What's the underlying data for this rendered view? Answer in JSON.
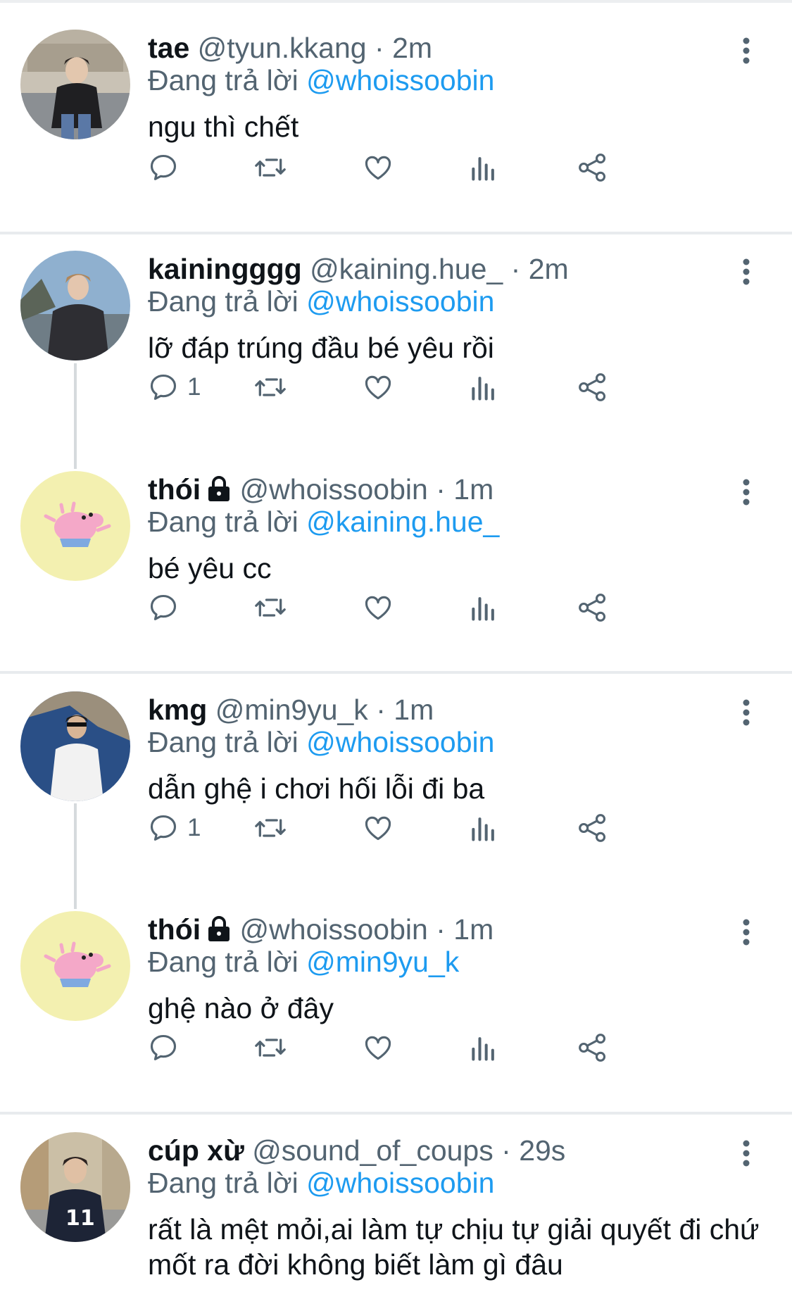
{
  "reply_prefix": "Đang trả lời",
  "tweets": [
    {
      "name": "tae",
      "handle": "@tyun.kkang",
      "dot": "·",
      "time": "2m",
      "reply_to": "@whoissoobin",
      "text": "ngu thì chết",
      "reply_count": "",
      "locked": false,
      "avatar": "person-photo"
    },
    {
      "name": "kainingggg",
      "handle": "@kaining.hue_",
      "dot": "·",
      "time": "2m",
      "reply_to": "@whoissoobin",
      "text": "lỡ đáp trúng đầu bé yêu rồi",
      "reply_count": "1",
      "locked": false,
      "avatar": "person-photo"
    },
    {
      "name": "thói",
      "handle": "@whoissoobin",
      "dot": "·",
      "time": "1m",
      "reply_to": "@kaining.hue_",
      "text": "bé yêu cc",
      "reply_count": "",
      "locked": true,
      "avatar": "peppa-pig-cartoon"
    },
    {
      "name": "kmg",
      "handle": "@min9yu_k",
      "dot": "·",
      "time": "1m",
      "reply_to": "@whoissoobin",
      "text": "dẫn ghệ i chơi hối lỗi đi ba",
      "reply_count": "1",
      "locked": false,
      "avatar": "person-photo"
    },
    {
      "name": "thói",
      "handle": "@whoissoobin",
      "dot": "·",
      "time": "1m",
      "reply_to": "@min9yu_k",
      "text": "ghệ nào ở đây",
      "reply_count": "",
      "locked": true,
      "avatar": "peppa-pig-cartoon"
    },
    {
      "name": "cúp xừ",
      "handle": "@sound_of_coups",
      "dot": "·",
      "time": "29s",
      "reply_to": "@whoissoobin",
      "text": "rất là mệt mỏi,ai làm tự chịu tự giải quyết đi chứ mốt ra đời không biết làm gì đâu",
      "reply_count": "",
      "locked": false,
      "avatar": "person-photo"
    }
  ],
  "colors": {
    "text": "#0f1419",
    "secondary": "#536471",
    "mention": "#1d9bf0",
    "separator": "#e8ebee",
    "peppa_avatar_bg": "#f3f0b0"
  },
  "icons": [
    "reply-icon",
    "retweet-icon",
    "like-icon",
    "views-icon",
    "share-icon",
    "more-icon",
    "lock-icon"
  ]
}
